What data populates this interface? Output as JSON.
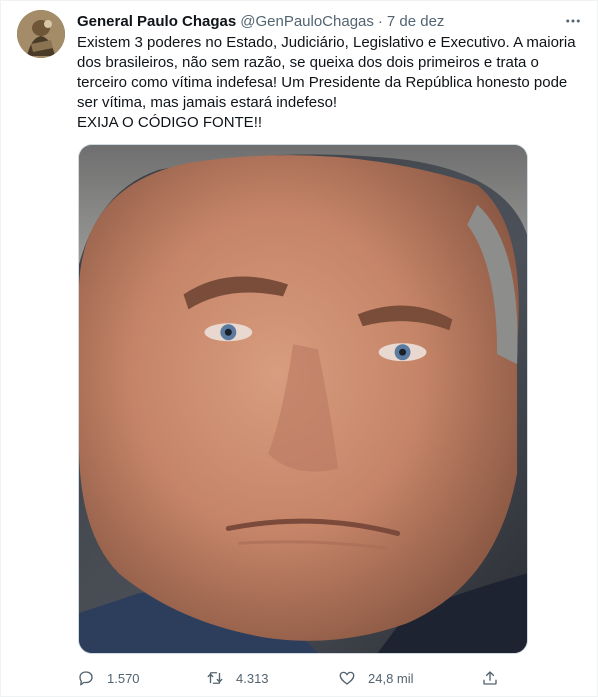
{
  "author": {
    "display_name": "General Paulo Chagas",
    "handle": "@GenPauloChagas",
    "separator": "·",
    "timestamp": "7 de dez"
  },
  "tweet": {
    "lines": [
      "Existem 3 poderes no Estado, Judiciário, Legislativo e Executivo. A maioria",
      "dos brasileiros, não sem razão, se queixa dos dois primeiros e trata o",
      "terceiro como vítima indefesa! Um Presidente da República honesto pode",
      "ser vítima, mas jamais estará indefeso!",
      "EXIJA O CÓDIGO FONTE!!"
    ]
  },
  "actions": {
    "reply_count": "1.570",
    "retweet_count": "4.313",
    "like_count": "24,8 mil"
  },
  "colors": {
    "text_primary": "#0f1419",
    "text_secondary": "#536471",
    "border": "#cfd9de"
  },
  "icons": {
    "more": "more-dots-icon",
    "reply": "reply-bubble-icon",
    "retweet": "retweet-icon",
    "like": "heart-icon",
    "share": "share-upload-icon"
  }
}
